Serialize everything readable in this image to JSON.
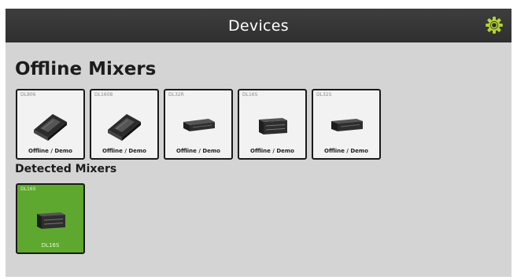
{
  "header": {
    "title": "Devices",
    "settings_icon": "gear-icon",
    "accent_color": "#b5d334"
  },
  "offline_section": {
    "title": "Offline Mixers",
    "tiles": [
      {
        "name": "DL806",
        "status": "Offline / Demo",
        "icon": "tablet-mixer-icon"
      },
      {
        "name": "DL1608",
        "status": "Offline / Demo",
        "icon": "tablet-mixer-icon"
      },
      {
        "name": "DL32R",
        "status": "Offline / Demo",
        "icon": "rack-mixer-icon"
      },
      {
        "name": "DL16S",
        "status": "Offline / Demo",
        "icon": "stagebox-mixer-icon"
      },
      {
        "name": "DL32S",
        "status": "Offline / Demo",
        "icon": "rack-mixer-icon"
      }
    ]
  },
  "detected_section": {
    "title": "Detected Mixers",
    "tiles": [
      {
        "name": "DL16S",
        "status": "DL16S",
        "icon": "stagebox-mixer-icon",
        "color": "#5fa830"
      }
    ]
  }
}
